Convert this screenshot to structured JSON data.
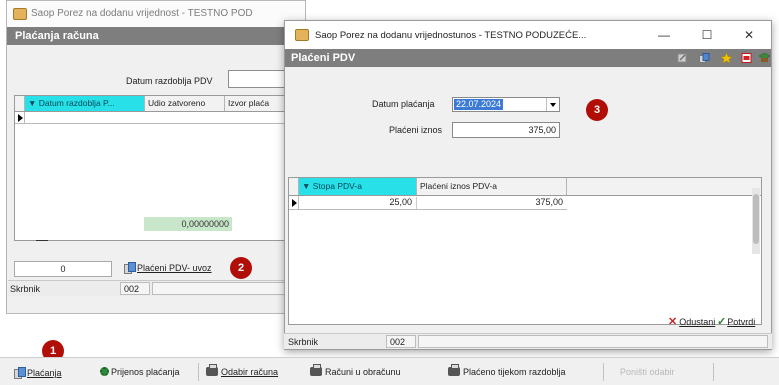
{
  "back_window": {
    "title": "Saop Porez na dodanu vrijednost - TESTNO POD",
    "header_title": "Plaćanja računa",
    "date_label": "Datum razdoblja PDV",
    "grid": {
      "columns": [
        "Datum razdoblja P...",
        "Udio zatvoreno",
        "Izvor plaća"
      ]
    },
    "total_value": "0,00000000",
    "count_value": "0",
    "placeni_uvoz_button": "Plaćeni PDV- uvoz",
    "status": {
      "user": "Skrbnik",
      "code": "002"
    }
  },
  "front_dialog": {
    "title": "Saop Porez na dodanu vrijednostunos - TESTNO PODUZEĆE...",
    "header_title": "Plaćeni PDV",
    "window_controls": {
      "minimize": "—",
      "maximize": "☐",
      "close": "✕"
    },
    "toolbar_icons": [
      "edit-icon",
      "copy-icon",
      "star-icon",
      "pdf-icon",
      "book-icon"
    ],
    "form": {
      "date_label": "Datum plaćanja",
      "date_value": "22.07.2024",
      "amount_label": "Plaćeni iznos",
      "amount_value": "375,00"
    },
    "grid": {
      "columns": [
        "Stopa PDV-a",
        "Plaćeni iznos PDV-a"
      ],
      "rows": [
        {
          "stopa": "25,00",
          "iznos": "375,00"
        }
      ]
    },
    "cancel_label": "Odustani",
    "confirm_label": "Potvrdi",
    "status": {
      "user": "Skrbnik",
      "code": "002"
    }
  },
  "badges": [
    "1",
    "2",
    "3"
  ],
  "bottom_toolbar": {
    "items": [
      {
        "label": "Plaćanja",
        "icon": "documents-icon"
      },
      {
        "label": "Prijenos plaćanja",
        "icon": "gear-icon"
      },
      {
        "label": "Odabir računa",
        "icon": "printer-icon"
      },
      {
        "label": "Računi u obračunu",
        "icon": "printer-icon"
      },
      {
        "label": "Plaćeno tijekom razdoblja",
        "icon": "printer-icon"
      },
      {
        "label": "Poništi odabir",
        "icon": "",
        "disabled": true
      }
    ]
  },
  "colors": {
    "header_gray": "#7e7e7e",
    "sorted_column": "#28e0e8",
    "badge_red": "#b10e08",
    "selection_blue": "#3b7bd6"
  }
}
